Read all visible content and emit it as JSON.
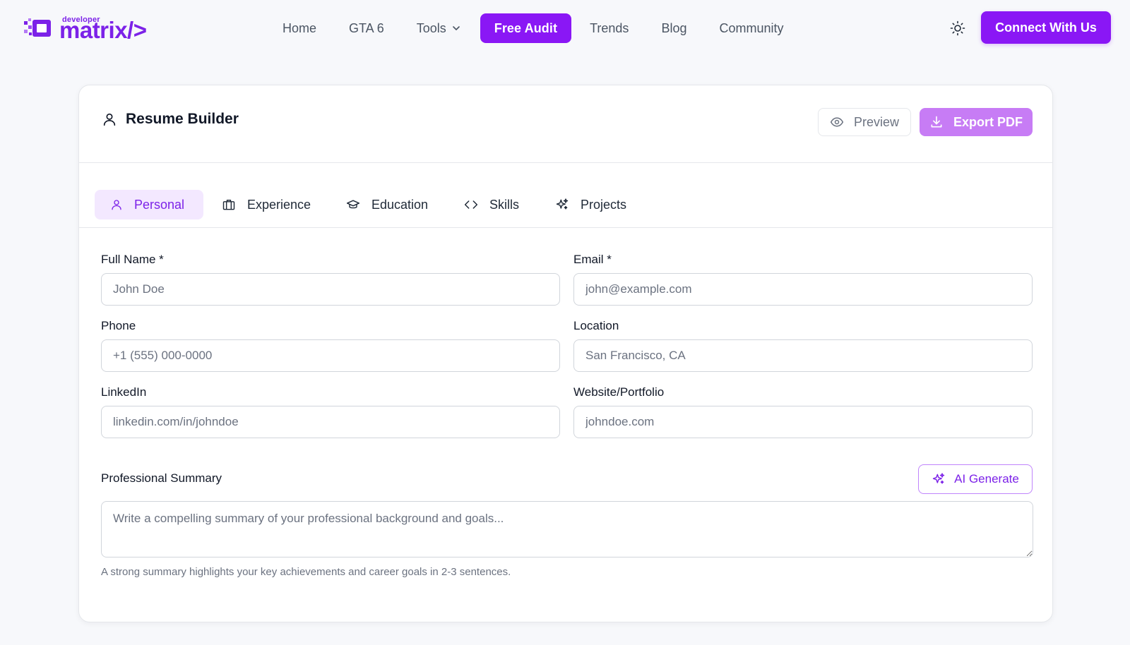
{
  "brand": {
    "small": "developer",
    "big": "matrix/>",
    "color": "#8a17f5"
  },
  "nav": {
    "links": [
      {
        "label": "Home"
      },
      {
        "label": "GTA 6"
      },
      {
        "label": "Tools"
      },
      {
        "label": "Free Audit"
      },
      {
        "label": "Trends"
      },
      {
        "label": "Blog"
      },
      {
        "label": "Community"
      }
    ],
    "theme_icon": "sun-icon",
    "connect_label": "Connect With Us"
  },
  "card": {
    "title": "Resume Builder",
    "preview_label": "Preview",
    "export_label": "Export PDF"
  },
  "tabs": [
    {
      "label": "Personal",
      "icon": "user-icon",
      "active": true
    },
    {
      "label": "Experience",
      "icon": "briefcase-icon",
      "active": false
    },
    {
      "label": "Education",
      "icon": "graduation-cap-icon",
      "active": false
    },
    {
      "label": "Skills",
      "icon": "code-icon",
      "active": false
    },
    {
      "label": "Projects",
      "icon": "sparkles-icon",
      "active": false
    }
  ],
  "form": {
    "full_name": {
      "label": "Full Name *",
      "placeholder": "John Doe",
      "value": ""
    },
    "email": {
      "label": "Email *",
      "placeholder": "john@example.com",
      "value": ""
    },
    "phone": {
      "label": "Phone",
      "placeholder": "+1 (555) 000-0000",
      "value": ""
    },
    "location": {
      "label": "Location",
      "placeholder": "San Francisco, CA",
      "value": ""
    },
    "linkedin": {
      "label": "LinkedIn",
      "placeholder": "linkedin.com/in/johndoe",
      "value": ""
    },
    "website": {
      "label": "Website/Portfolio",
      "placeholder": "johndoe.com",
      "value": ""
    },
    "summary": {
      "label": "Professional Summary",
      "placeholder": "Write a compelling summary of your professional background and goals...",
      "ai_label": "AI Generate",
      "hint": "A strong summary highlights your key achievements and career goals in 2-3 sentences."
    }
  },
  "colors": {
    "accent": "#8a17f5",
    "accent_light": "#c77cf5",
    "tab_active_bg": "#f3e8ff"
  }
}
